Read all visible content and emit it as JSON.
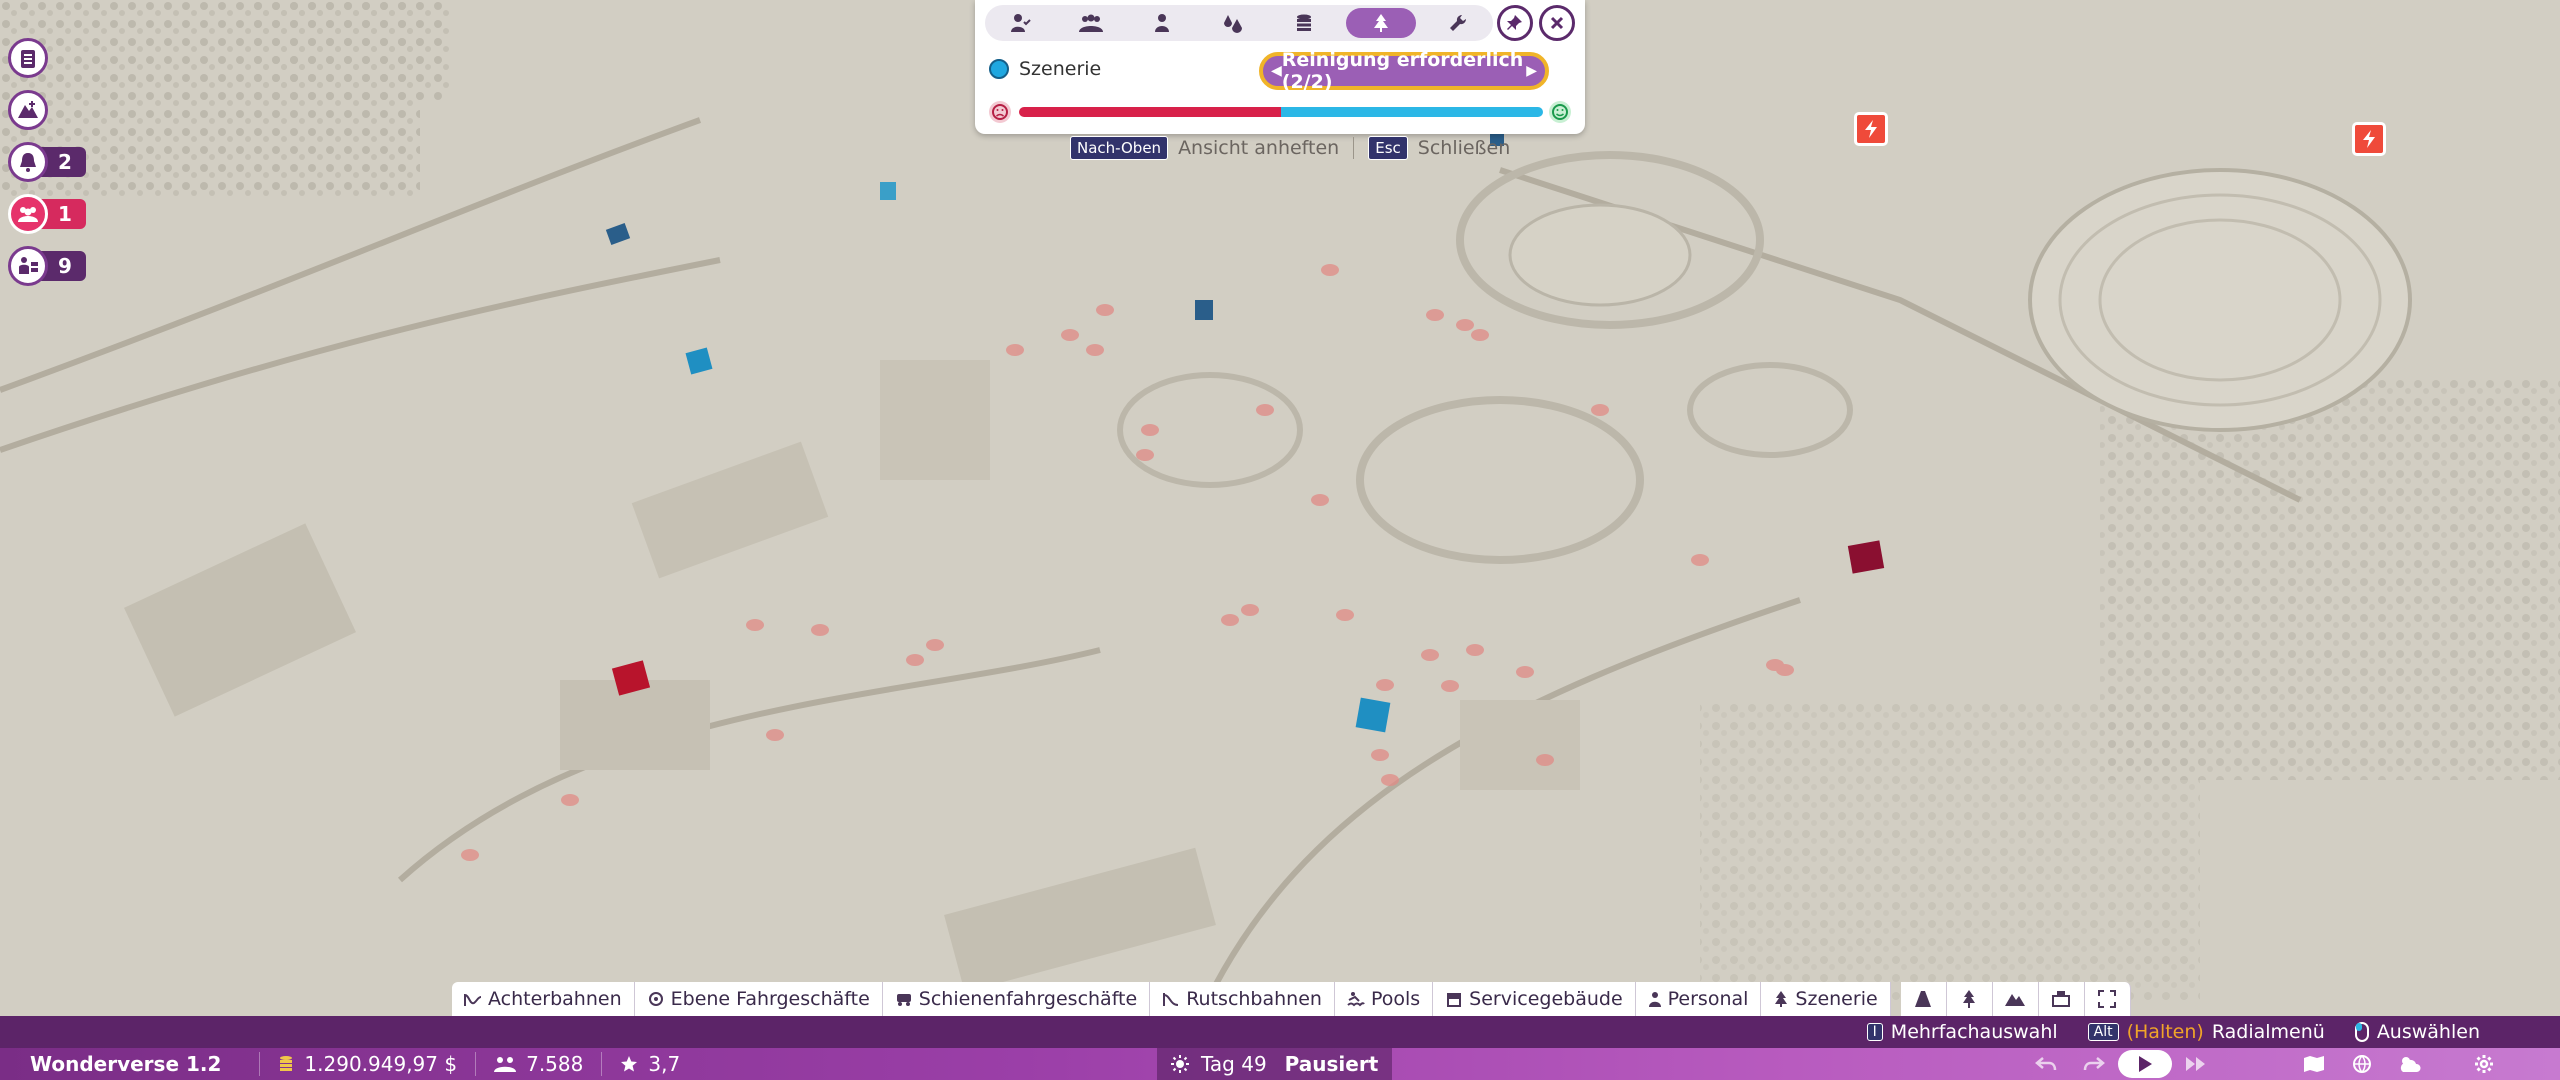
{
  "side_stack": [
    {
      "icon": "clipboard-icon",
      "count": ""
    },
    {
      "icon": "terrain-add-icon",
      "count": ""
    },
    {
      "icon": "bell-icon",
      "count": "2"
    },
    {
      "icon": "guests-icon",
      "count": "1",
      "alert": true
    },
    {
      "icon": "staff-tasks-icon",
      "count": "9"
    }
  ],
  "heatmap": {
    "category_label": "Szenerie",
    "need_label": "Reinigung erforderlich (2/2)",
    "bar_red_fraction": 0.5
  },
  "hints": {
    "pin_key": "Nach-Oben",
    "pin_label": "Ansicht anheften",
    "close_key": "Esc",
    "close_label": "Schließen"
  },
  "categories": [
    {
      "label": "Achterbahnen",
      "icon": "coaster-icon"
    },
    {
      "label": "Ebene Fahrgeschäfte",
      "icon": "flat-ride-icon"
    },
    {
      "label": "Schienenfahrgeschäfte",
      "icon": "track-ride-icon"
    },
    {
      "label": "Rutschbahnen",
      "icon": "slide-icon"
    },
    {
      "label": "Pools",
      "icon": "pool-icon"
    },
    {
      "label": "Servicegebäude",
      "icon": "shop-icon"
    },
    {
      "label": "Personal",
      "icon": "staff-icon"
    },
    {
      "label": "Szenerie",
      "icon": "scenery-icon"
    }
  ],
  "control_hints": {
    "multi_key": "I",
    "multi_label": "Mehrfachauswahl",
    "radial_key": "Alt",
    "radial_hold": "(Halten)",
    "radial_label": "Radialmenü",
    "select_label": "Auswählen"
  },
  "status": {
    "park_name": "Wonderverse 1.2",
    "money": "1.290.949,97 $",
    "guests": "7.588",
    "rating": "3,7",
    "day": "Tag 49",
    "state": "Pausiert"
  },
  "colors": {
    "panel_accent": "#9b5fb5",
    "heat_red": "#d8214a",
    "heat_blue": "#2bb7e6",
    "status_purple": "#5c2468"
  }
}
